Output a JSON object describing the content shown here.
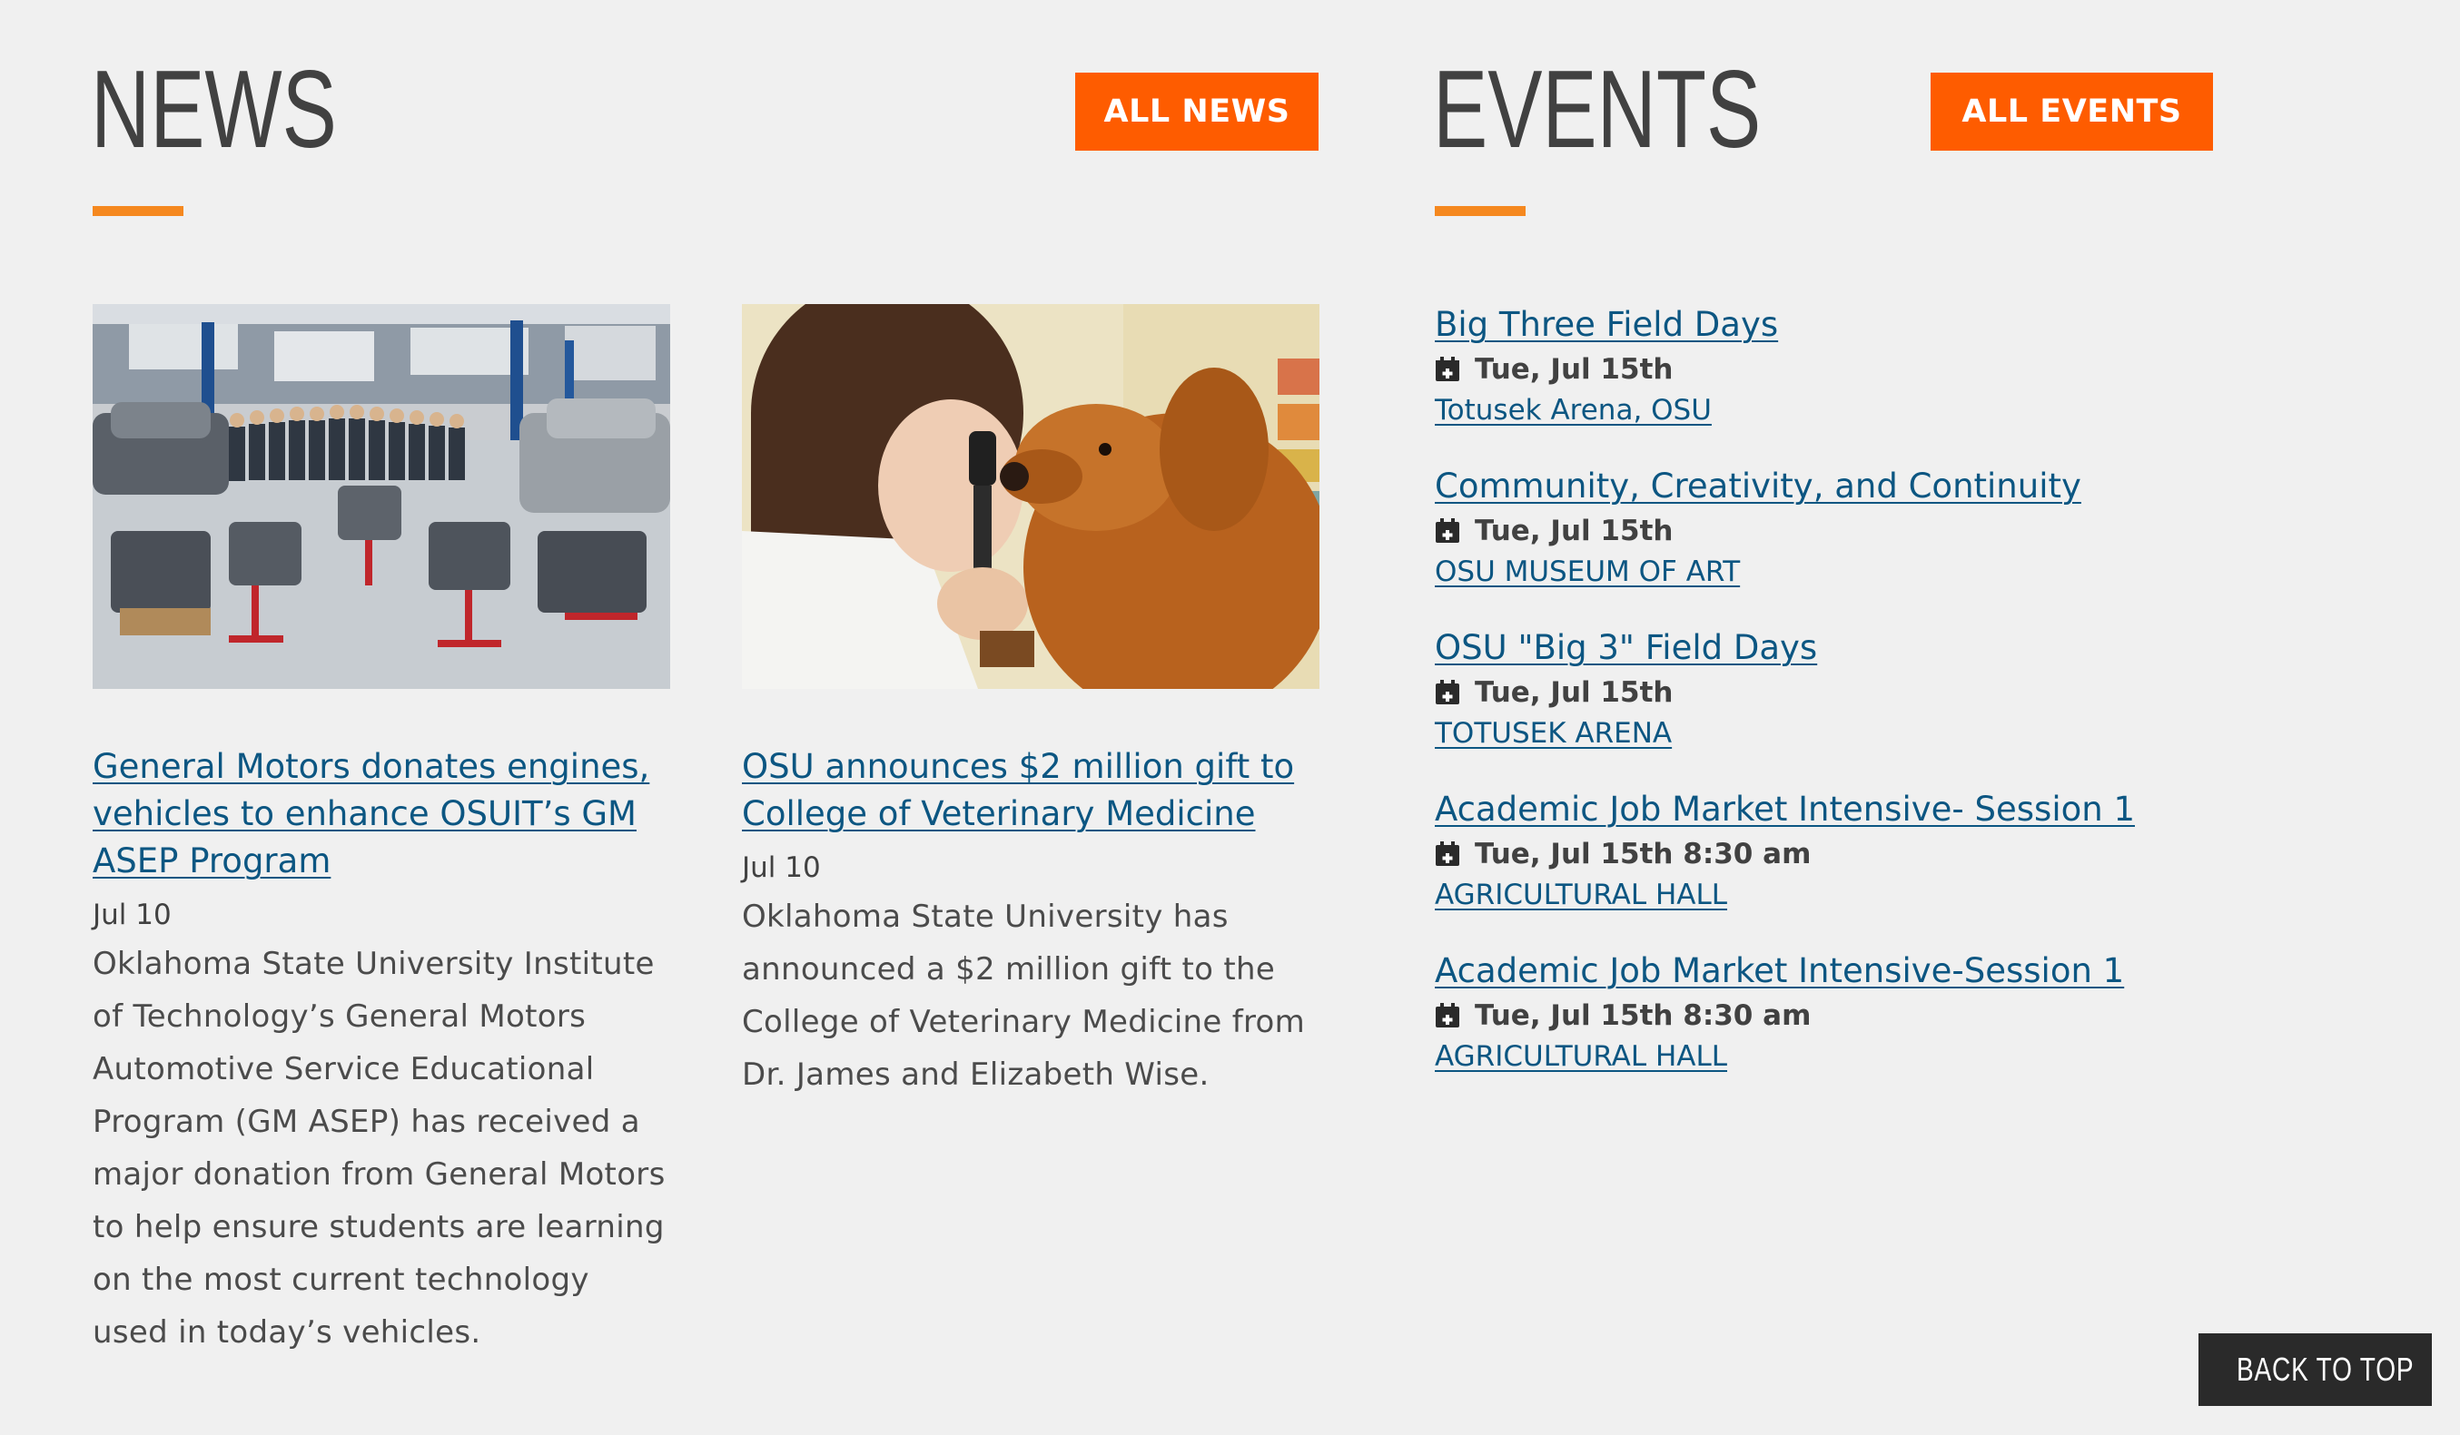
{
  "news": {
    "heading": "NEWS",
    "all_button": "ALL NEWS",
    "items": [
      {
        "image": "gm-asep-shop-photo",
        "headline": "General Motors donates engines, vehicles to enhance OSUIT’s GM ASEP Program",
        "date": "Jul 10",
        "description": "Oklahoma State University Institute of Technology’s General Motors Automotive Service Educational Program (GM ASEP) has received a major donation from General Motors to help ensure students are learning on the most current technology used in today’s vehicles."
      },
      {
        "image": "vet-exam-dog-photo",
        "headline": "OSU announces $2 million gift to College of Veterinary Medicine",
        "date": "Jul 10",
        "description": "Oklahoma State University has announced a $2 million gift to the College of Veterinary Medicine from Dr. James and Elizabeth Wise."
      }
    ]
  },
  "events": {
    "heading": "EVENTS",
    "all_button": "ALL EVENTS",
    "items": [
      {
        "title": "Big Three Field Days",
        "date": "Tue, Jul 15th",
        "location": "Totusek Arena, OSU"
      },
      {
        "title": "Community, Creativity, and Continuity",
        "date": "Tue, Jul 15th",
        "location": "OSU MUSEUM OF ART"
      },
      {
        "title": "OSU \"Big 3\" Field Days",
        "date": "Tue, Jul 15th",
        "location": "TOTUSEK ARENA"
      },
      {
        "title": "Academic Job Market Intensive- Session 1",
        "date": "Tue, Jul 15th 8:30 am",
        "location": "AGRICULTURAL HALL"
      },
      {
        "title": "Academic Job Market Intensive-Session 1",
        "date": "Tue, Jul 15th 8:30 am",
        "location": "AGRICULTURAL HALL"
      }
    ]
  },
  "back_to_top": "BACK TO TOP",
  "colors": {
    "accent_orange": "#fe5c00",
    "underline_orange": "#f5881f",
    "link_blue": "#0c5682",
    "heading_gray": "#414141",
    "background": "#f0f0f0"
  }
}
